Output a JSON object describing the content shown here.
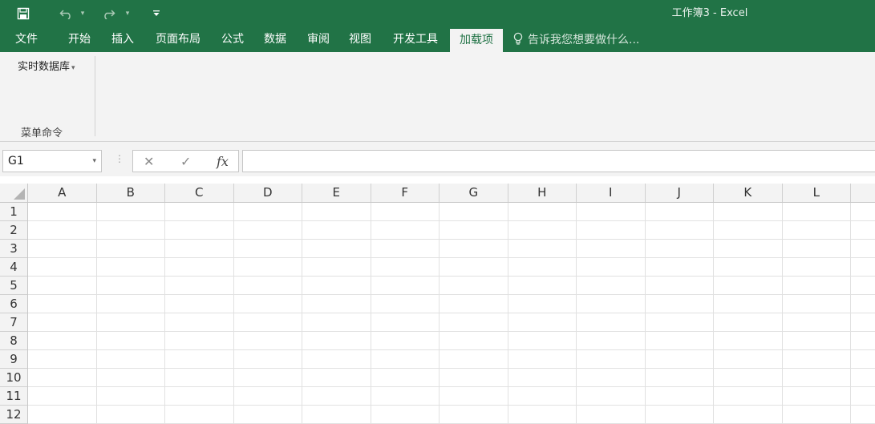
{
  "window": {
    "title": "工作簿3 - Excel"
  },
  "quick_access": {
    "save_icon": "save-icon",
    "undo_icon": "undo-icon",
    "redo_icon": "redo-icon",
    "customize_icon": "customize-arrow-icon"
  },
  "tabs": [
    {
      "label": "文件",
      "active": false
    },
    {
      "label": "开始",
      "active": false
    },
    {
      "label": "插入",
      "active": false
    },
    {
      "label": "页面布局",
      "active": false
    },
    {
      "label": "公式",
      "active": false
    },
    {
      "label": "数据",
      "active": false
    },
    {
      "label": "审阅",
      "active": false
    },
    {
      "label": "视图",
      "active": false
    },
    {
      "label": "开发工具",
      "active": false
    },
    {
      "label": "加载项",
      "active": true
    }
  ],
  "tell_me": {
    "text": "告诉我您想要做什么...",
    "icon": "lightbulb-icon"
  },
  "ribbon": {
    "button_label": "实时数据库",
    "dropdown_arrow": "▾",
    "group_label": "菜单命令"
  },
  "formula_bar": {
    "name_box": "G1",
    "name_arrow": "▾",
    "dots": "⋮",
    "cancel": "✕",
    "enter": "✓",
    "fx": "fx",
    "formula": ""
  },
  "grid": {
    "columns": [
      "A",
      "B",
      "C",
      "D",
      "E",
      "F",
      "G",
      "H",
      "I",
      "J",
      "K",
      "L"
    ],
    "rows": [
      "1",
      "2",
      "3",
      "4",
      "5",
      "6",
      "7",
      "8",
      "9",
      "10",
      "11",
      "12"
    ]
  },
  "colors": {
    "accent": "#217346",
    "ribbon_bg": "#f3f3f3"
  }
}
